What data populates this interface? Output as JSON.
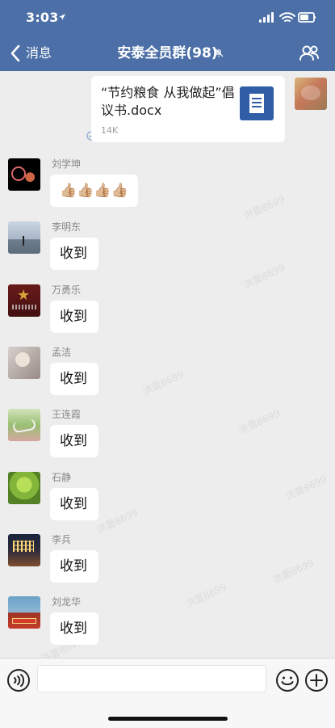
{
  "status_bar": {
    "time": "3:03"
  },
  "nav": {
    "back_label": "消息",
    "title": "安泰全员群(98)"
  },
  "file_message": {
    "title": "“节约粮食 从我做起”倡议书.docx",
    "size": "14K"
  },
  "messages": [
    {
      "sender": "刘学坤",
      "text": "👍🏼👍🏼👍🏼👍🏼"
    },
    {
      "sender": "李明东",
      "text": "收到"
    },
    {
      "sender": "万勇乐",
      "text": "收到"
    },
    {
      "sender": "孟洁",
      "text": "收到"
    },
    {
      "sender": "王连霞",
      "text": "收到"
    },
    {
      "sender": "石静",
      "text": "收到"
    },
    {
      "sender": "李兵",
      "text": "收到"
    },
    {
      "sender": "刘龙华",
      "text": "收到"
    }
  ],
  "watermarks": [
    "洪蕾8699",
    "洪蕾8699",
    "洪蕾8699",
    "洪蕾8699",
    "洪蕾8699",
    "洪蕾8699",
    "洪蕾8699",
    "洪蕾8699",
    "洪蕾8699"
  ]
}
